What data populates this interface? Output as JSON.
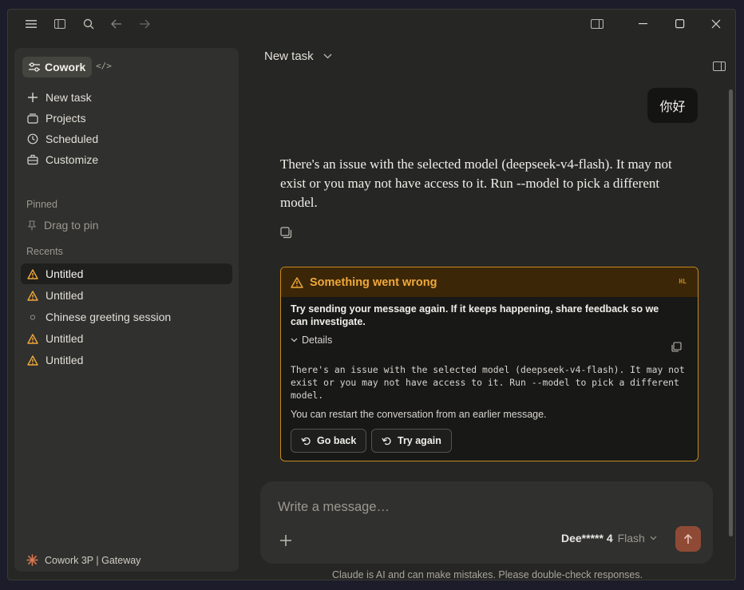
{
  "titlebar": {
    "icons": [
      "menu-icon",
      "sidebar-toggle-icon",
      "search-icon",
      "back-arrow-icon",
      "forward-arrow-icon",
      "panel-icon",
      "minimize-icon",
      "maximize-icon",
      "close-icon"
    ]
  },
  "sidebar": {
    "mode_label": "Cowork",
    "nav": [
      {
        "label": "New task",
        "icon": "plus-icon"
      },
      {
        "label": "Projects",
        "icon": "folder-icon"
      },
      {
        "label": "Scheduled",
        "icon": "clock-icon"
      },
      {
        "label": "Customize",
        "icon": "briefcase-icon"
      }
    ],
    "pinned_label": "Pinned",
    "drag_to_pin": "Drag to pin",
    "recents_label": "Recents",
    "recents": [
      {
        "label": "Untitled",
        "icon": "warning-icon"
      },
      {
        "label": "Untitled",
        "icon": "warning-icon"
      },
      {
        "label": "Chinese greeting session",
        "icon": "circle-icon"
      },
      {
        "label": "Untitled",
        "icon": "warning-icon"
      },
      {
        "label": "Untitled",
        "icon": "warning-icon"
      }
    ],
    "footer_label": "Cowork 3P | Gateway"
  },
  "main": {
    "task_title": "New task",
    "user_message": "你好",
    "assistant_message": "There's an issue with the selected model (deepseek-v4-flash). It may not exist or you may not have access to it. Run --model to pick a different model.",
    "error": {
      "title": "Something went wrong",
      "badge": "HL",
      "message": "Try sending your message again. If it keeps happening, share feedback so we can investigate.",
      "details_label": "Details",
      "details_text": "There's an issue with the selected model (deepseek-v4-flash). It may not exist or you may not have access to it. Run --model to pick a different model.",
      "restart_text": "You can restart the conversation from an earlier message.",
      "go_back_label": "Go back",
      "try_again_label": "Try again"
    },
    "composer": {
      "placeholder": "Write a message…",
      "model_name": "Dee***** 4",
      "model_variant": "Flash"
    },
    "disclaimer": "Claude is AI and can make mistakes. Please double-check responses."
  },
  "colors": {
    "accent_warning": "#f0a83a",
    "send_button": "#8f4a35",
    "background": "#262624"
  }
}
